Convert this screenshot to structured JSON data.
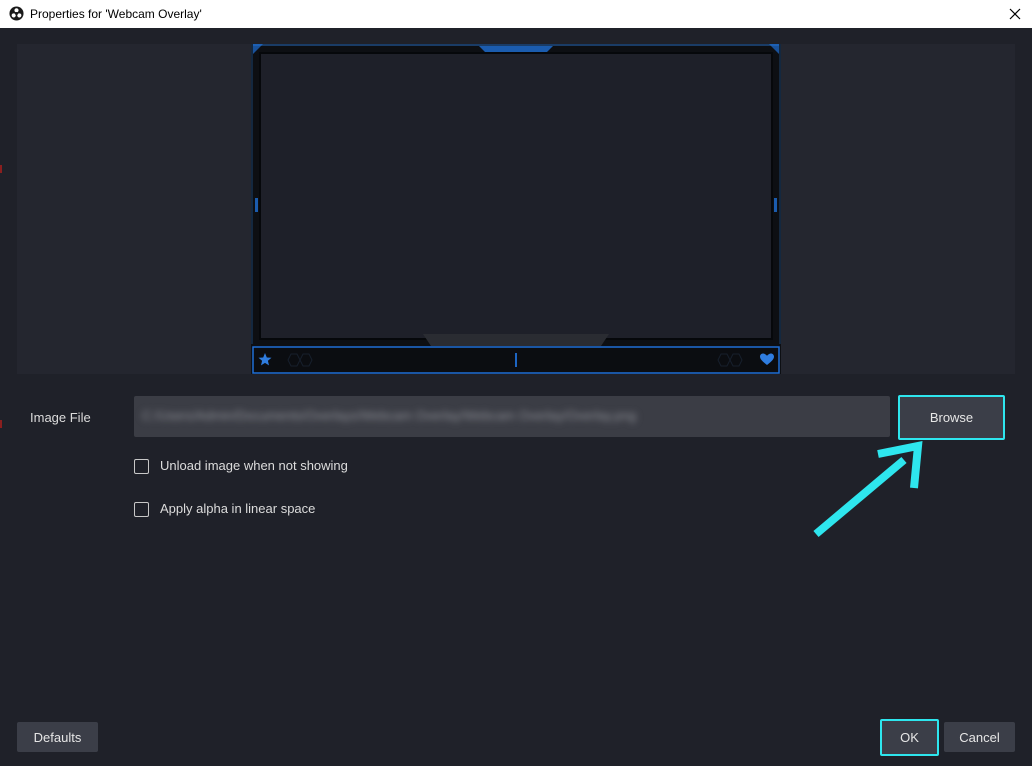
{
  "window": {
    "title": "Properties for 'Webcam Overlay'"
  },
  "form": {
    "image_file_label": "Image File",
    "image_file_path": "C:/Users/Admin/Documents/Overlays/Webcam Overlay/Webcam Overlay/Overlay.png",
    "browse_label": "Browse",
    "unload_label": "Unload image when not showing",
    "unload_checked": false,
    "alpha_label": "Apply alpha in linear space",
    "alpha_checked": false
  },
  "footer": {
    "defaults_label": "Defaults",
    "ok_label": "OK",
    "cancel_label": "Cancel"
  },
  "colors": {
    "background": "#1f2129",
    "preview_bg": "#24262f",
    "button_bg": "#3b3e48",
    "highlight": "#2ee6ee",
    "overlay_accent": "#1f6fd6"
  },
  "icons": {
    "app": "obs-logo-icon",
    "close": "close-icon",
    "overlay_left": "star-icon",
    "overlay_right": "heart-icon",
    "annotation": "arrow-icon"
  }
}
